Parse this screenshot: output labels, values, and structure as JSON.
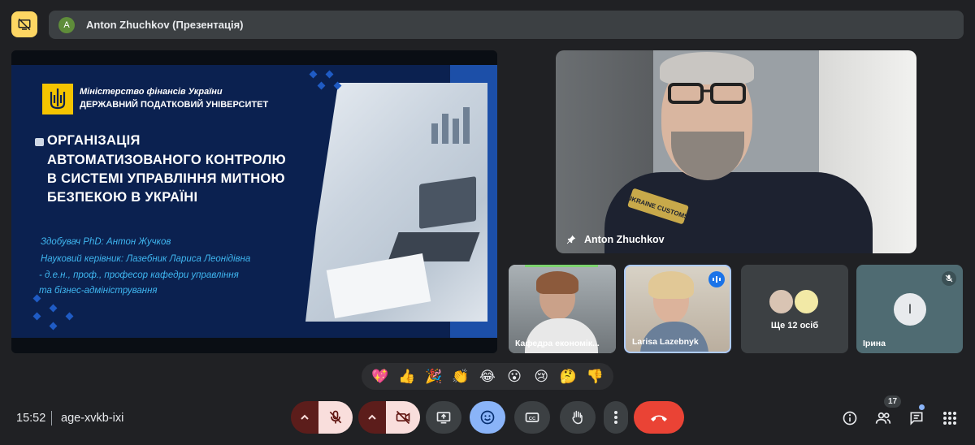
{
  "presentation_banner": {
    "avatar_letter": "A",
    "text": "Anton Zhuchkov (Презентація)"
  },
  "slide": {
    "ministry": "Міністерство фінансів України",
    "university": "ДЕРЖАВНИЙ ПОДАТКОВИЙ УНІВЕРСИТЕТ",
    "title_lines": [
      "ОРГАНІЗАЦІЯ",
      "АВТОМАТИЗОВАНОГО КОНТРОЛЮ",
      "В СИСТЕМІ УПРАВЛІННЯ МИТНОЮ",
      "БЕЗПЕКОЮ В УКРАЇНІ"
    ],
    "info_lines": [
      "Здобувач PhD: Антон Жучков",
      "Науковий керівник: Лазебник Лариса Леонідівна",
      "- д.е.н., проф., професор кафедри управління",
      "та бізнес-адміністрування"
    ]
  },
  "speaker": {
    "name": "Anton Zhuchkov",
    "patch_text": "UKRAINE CUSTOMS"
  },
  "tiles": [
    {
      "name": "Кафедра економік..."
    },
    {
      "name": "Larisa Lazebnyk"
    },
    {
      "name": "Ще 12 осіб"
    },
    {
      "name": "Ірина",
      "avatar_letter": "І"
    }
  ],
  "reactions": [
    "💖",
    "👍",
    "🎉",
    "👏",
    "😂",
    "😮",
    "😢",
    "🤔",
    "👎"
  ],
  "bottom_bar": {
    "time": "15:52",
    "meeting_code": "age-xvkb-ixi",
    "participants_count": "17"
  },
  "colors": {
    "end_call": "#ea4335",
    "muted_bg": "#f9dedc",
    "accent_blue": "#8ab4f8",
    "present_yellow": "#fdd663"
  }
}
